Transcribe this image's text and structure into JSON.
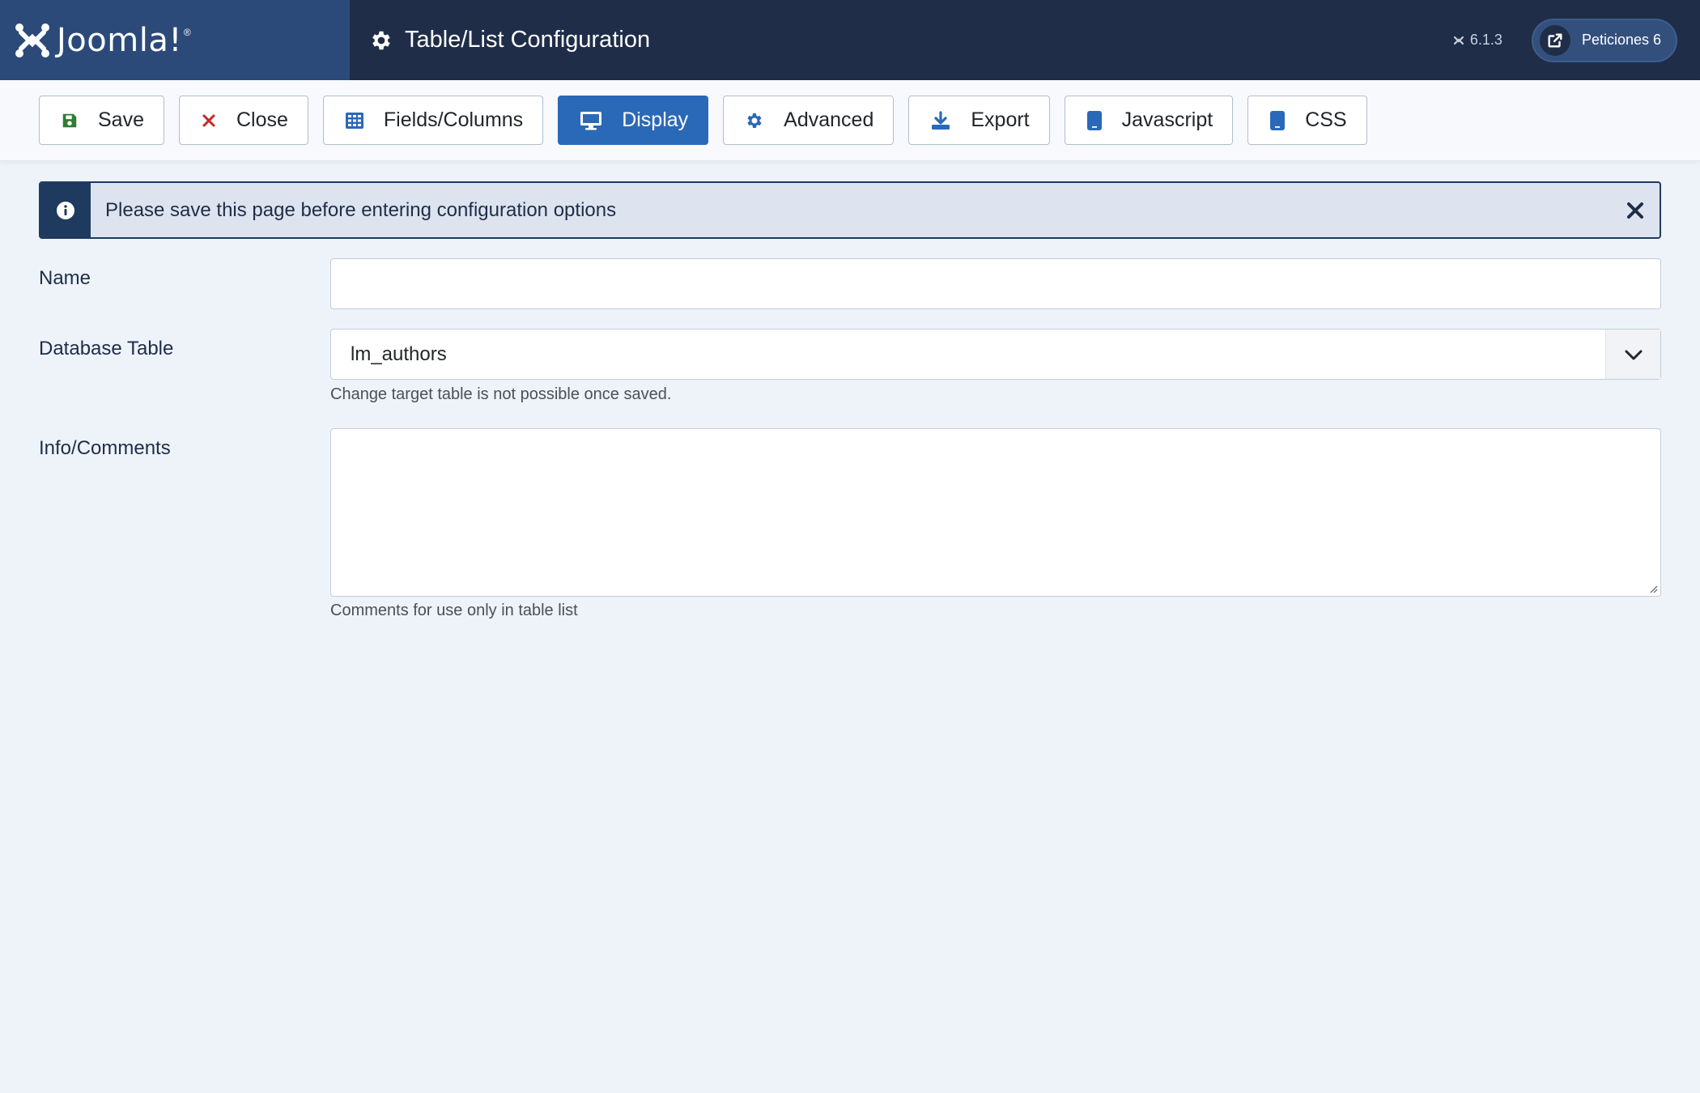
{
  "header": {
    "logo_text": "Joomla!",
    "page_title": "Table/List Configuration",
    "version": "6.1.3",
    "requests_label": "Peticiones 6"
  },
  "toolbar": {
    "buttons": [
      {
        "label": "Save",
        "icon": "save-icon",
        "color": "#2f7d32"
      },
      {
        "label": "Close",
        "icon": "close-icon",
        "color": "#c52827"
      },
      {
        "label": "Fields/Columns",
        "icon": "grid-icon",
        "color": "#2a69b8"
      },
      {
        "label": "Display",
        "icon": "monitor-icon",
        "color": "#ffffff",
        "active": true
      },
      {
        "label": "Advanced",
        "icon": "gear-icon",
        "color": "#2a69b8"
      },
      {
        "label": "Export",
        "icon": "download-icon",
        "color": "#2a69b8"
      },
      {
        "label": "Javascript",
        "icon": "tablet-icon",
        "color": "#2a69b8"
      },
      {
        "label": "CSS",
        "icon": "tablet-icon",
        "color": "#2a69b8"
      }
    ]
  },
  "alert": {
    "message": "Please save this page before entering configuration options"
  },
  "form": {
    "name": {
      "label": "Name",
      "value": ""
    },
    "database_table": {
      "label": "Database Table",
      "value": "lm_authors",
      "help": "Change target table is not possible once saved."
    },
    "info": {
      "label": "Info/Comments",
      "value": "",
      "help": "Comments for use only in table list"
    }
  },
  "colors": {
    "header_bg": "#1f2d48",
    "logo_bg": "#2b4a7a",
    "accent": "#2a69b8",
    "page_bg": "#eef3fa"
  }
}
